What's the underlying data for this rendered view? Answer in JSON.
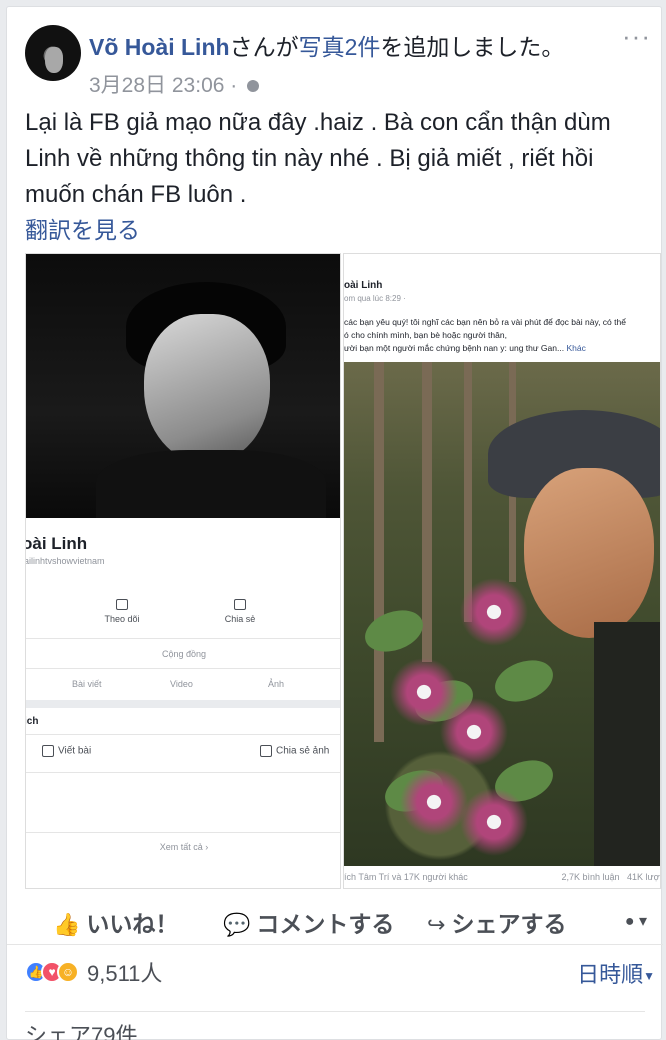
{
  "post": {
    "author": "Võ Hoài Linh",
    "header_mid": "さんが",
    "header_link": "写真2件",
    "header_tail": "を追加しました。",
    "timestamp": "3月28日 23:06",
    "separator": "·",
    "privacy_icon": "globe-icon",
    "more_label": "···",
    "text": "Lại là FB giả mạo nữa đây .haiz . Bà con cẩn thận dùm Linh về những thông tin này nhé . Bị giả miết , riết hồi muốn chán FB luôn .",
    "translate_label": "翻訳を見る"
  },
  "photo_left": {
    "name": "oài Linh",
    "url": "ailinhtvshowvietnam",
    "follow_label": "Theo dõi",
    "share_label": "Chia sẻ",
    "community_label": "Cộng đồng",
    "tabs": [
      "Bài viết",
      "Video",
      "Ảnh"
    ],
    "section_label": "ich",
    "write_label": "Viết bài",
    "photo_label": "Chia sẻ ảnh",
    "see_all_label": "Xem tất cả"
  },
  "photo_right": {
    "name": "oài Linh",
    "time": "om qua lúc 8:29 · ",
    "lines": [
      "các bạn yêu quý! tôi nghĩ các bạn nên bỏ ra vài phút để đọc bài này, có thể",
      "ó cho chính mình, bạn bè hoặc người thân,",
      "ười bạn một người mắc chứng bệnh nan y: ung thư Gan... "
    ],
    "more_link": "Khác",
    "footer_left": "ích Tâm Trí và 17K người khác",
    "footer_comments": "2,7K bình luận",
    "footer_shares": "41K lượt"
  },
  "actions": {
    "like": "いいね！",
    "comment": "コメントする",
    "share": "シェアする"
  },
  "reactions": {
    "count": "9,511人",
    "sort_label": "日時順",
    "share_count": "シェア79件"
  }
}
